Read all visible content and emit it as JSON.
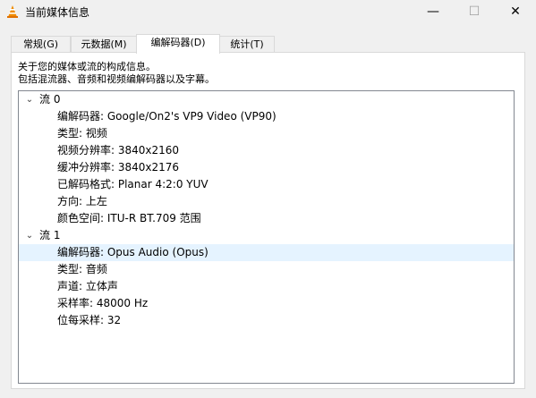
{
  "window": {
    "title": "当前媒体信息",
    "icon": "vlc-cone-icon",
    "controls": {
      "minimize": "—",
      "maximize": "☐",
      "close": "✕"
    }
  },
  "tabs": [
    {
      "label": "常规(G)"
    },
    {
      "label": "元数据(M)"
    },
    {
      "label": "编解码器(D)"
    },
    {
      "label": "统计(T)"
    }
  ],
  "active_tab": "编解码器(D)",
  "codec_panel": {
    "description_line1": "关于您的媒体或流的构成信息。",
    "description_line2": "包括混流器、音频和视频编解码器以及字幕。",
    "streams": [
      {
        "label": "流 0",
        "expanded": true,
        "details": [
          "编解码器: Google/On2's VP9 Video (VP90)",
          "类型: 视频",
          "视频分辨率: 3840x2160",
          "缓冲分辨率: 3840x2176",
          "已解码格式: Planar 4:2:0 YUV",
          "方向: 上左",
          "颜色空间: ITU-R BT.709 范围"
        ]
      },
      {
        "label": "流 1",
        "expanded": true,
        "details": [
          "编解码器: Opus Audio (Opus)",
          "类型: 音频",
          "声道: 立体声",
          "采样率: 48000 Hz",
          "位每采样: 32"
        ]
      }
    ]
  }
}
